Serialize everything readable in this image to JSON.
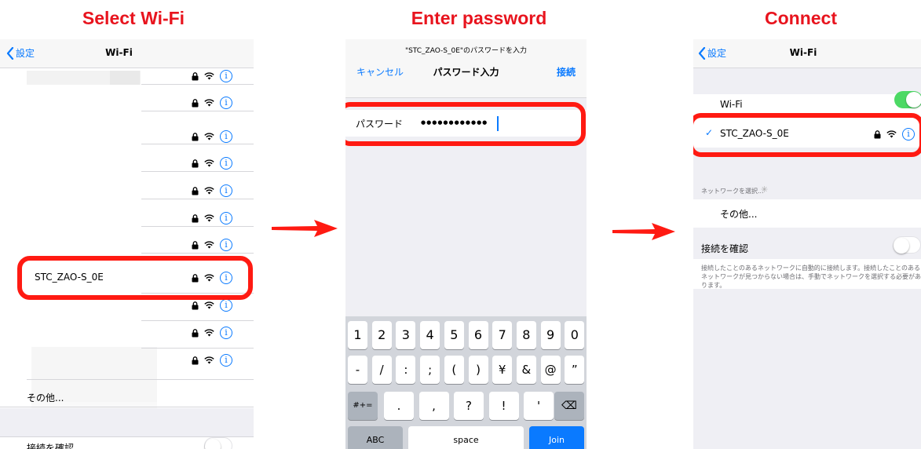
{
  "steps": {
    "select": "Select Wi-Fi",
    "password": "Enter password",
    "connect": "Connect"
  },
  "colors": {
    "highlight_red": "#ff1a12",
    "title_red": "#e8141e",
    "ios_blue": "#0a7aff",
    "ios_green": "#4cd964"
  },
  "phone1": {
    "back_label": "設定",
    "title": "Wi-Fi",
    "highlighted_network": "STC_ZAO-S_0E",
    "other_label": "その他...",
    "confirm_label": "接続を確認",
    "confirm_toggle": false,
    "icons": [
      "lock-icon",
      "wifi-icon",
      "info-icon"
    ]
  },
  "phone2": {
    "prompt": "\"STC_ZAO-S_0E\"のパスワードを入力",
    "cancel_label": "キャンセル",
    "title": "パスワード入力",
    "join_label": "接続",
    "password_label": "パスワード",
    "password_dots": "●●●●●●●●●●●●",
    "keyboard": {
      "row1": [
        "1",
        "2",
        "3",
        "4",
        "5",
        "6",
        "7",
        "8",
        "9",
        "0"
      ],
      "row2": [
        "-",
        "/",
        ":",
        ";",
        "(",
        ")",
        "¥",
        "&",
        "@",
        "”"
      ],
      "row3": [
        "#+=",
        ".",
        ",",
        "?",
        "!",
        "'",
        "⌫"
      ],
      "row4": [
        "ABC",
        "space",
        "Join"
      ]
    }
  },
  "phone3": {
    "back_label": "設定",
    "title": "Wi-Fi",
    "wifi_label": "Wi-Fi",
    "wifi_toggle": true,
    "connected_network": "STC_ZAO-S_0E",
    "check": "✓",
    "choose_network_label": "ネットワークを選択...",
    "other_label": "その他...",
    "confirm_label": "接続を確認",
    "confirm_toggle": false,
    "description": "接続したことのあるネットワークに自動的に接続します。接続したことのあるネットワークが見つからない場合は、手動でネットワークを選択する必要があります。"
  }
}
